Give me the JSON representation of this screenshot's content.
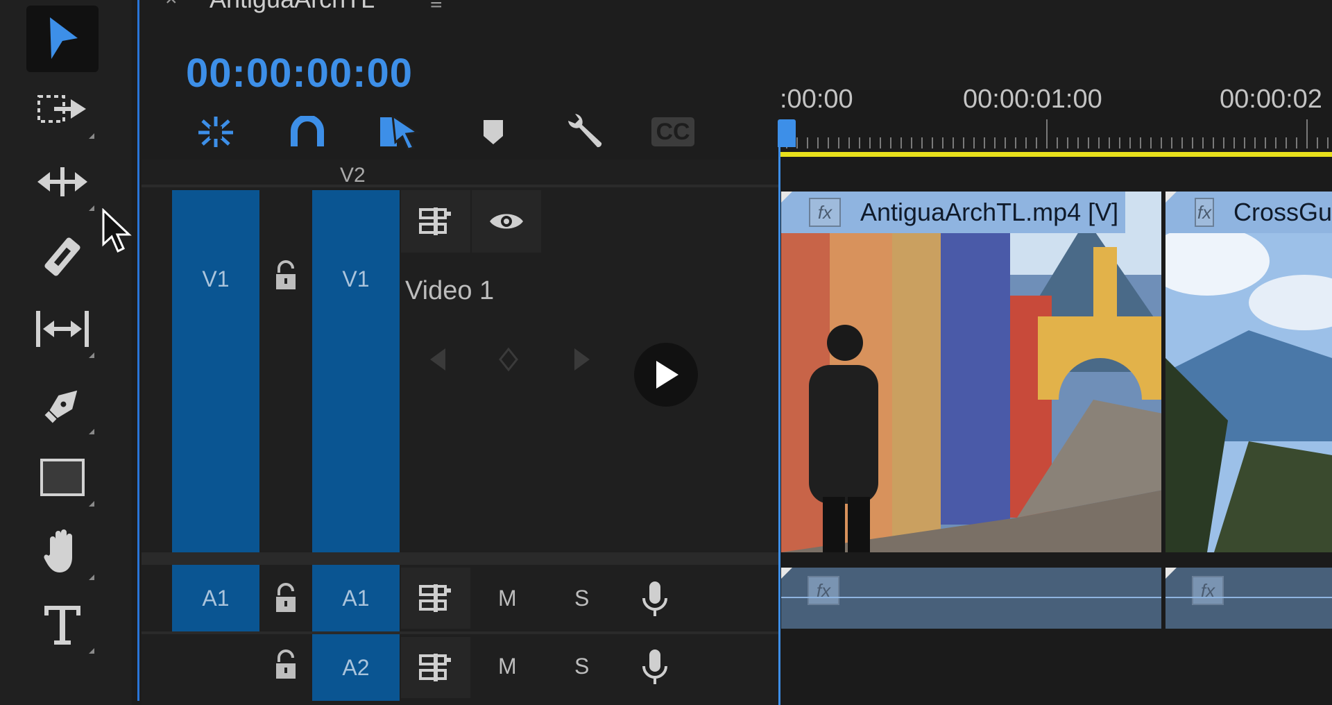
{
  "sequence": {
    "close_glyph": "×",
    "title": "AntiguaArchTL",
    "menu_glyph": "≡",
    "timecode": "00:00:00:00"
  },
  "tools": [
    {
      "name": "selection-tool",
      "icon": "arrow-icon"
    },
    {
      "name": "track-select-tool",
      "icon": "track-select-forward-icon"
    },
    {
      "name": "ripple-edit-tool",
      "icon": "ripple-edit-icon"
    },
    {
      "name": "razor-tool",
      "icon": "razor-icon"
    },
    {
      "name": "slip-tool",
      "icon": "slip-icon"
    },
    {
      "name": "pen-tool",
      "icon": "pen-icon"
    },
    {
      "name": "rectangle-tool",
      "icon": "rectangle-icon"
    },
    {
      "name": "hand-tool",
      "icon": "hand-icon"
    },
    {
      "name": "type-tool",
      "icon": "type-icon"
    }
  ],
  "timeline_tools": {
    "captions_label": "CC"
  },
  "tracks": {
    "v2_label": "V2",
    "v1": {
      "source_label": "V1",
      "target_label": "V1",
      "name": "Video 1"
    },
    "a1": {
      "source_label": "A1",
      "target_label": "A1",
      "mute": "M",
      "solo": "S"
    },
    "a2": {
      "target_label": "A2",
      "mute": "M",
      "solo": "S"
    }
  },
  "ruler": {
    "labels": [
      ":00:00",
      "00:00:01:00",
      "00:00:02"
    ]
  },
  "clips": {
    "video": [
      {
        "fx": "fx",
        "name": "AntiguaArchTL.mp4 [V]"
      },
      {
        "fx": "fx",
        "name": "CrossGu"
      }
    ],
    "audio": [
      {
        "fx": "fx"
      },
      {
        "fx": "fx"
      }
    ]
  },
  "colors": {
    "accent": "#3d8fe8",
    "track_target": "#0a5592",
    "work_area": "#e8e01c",
    "clip_label": "#8fb4e0"
  }
}
